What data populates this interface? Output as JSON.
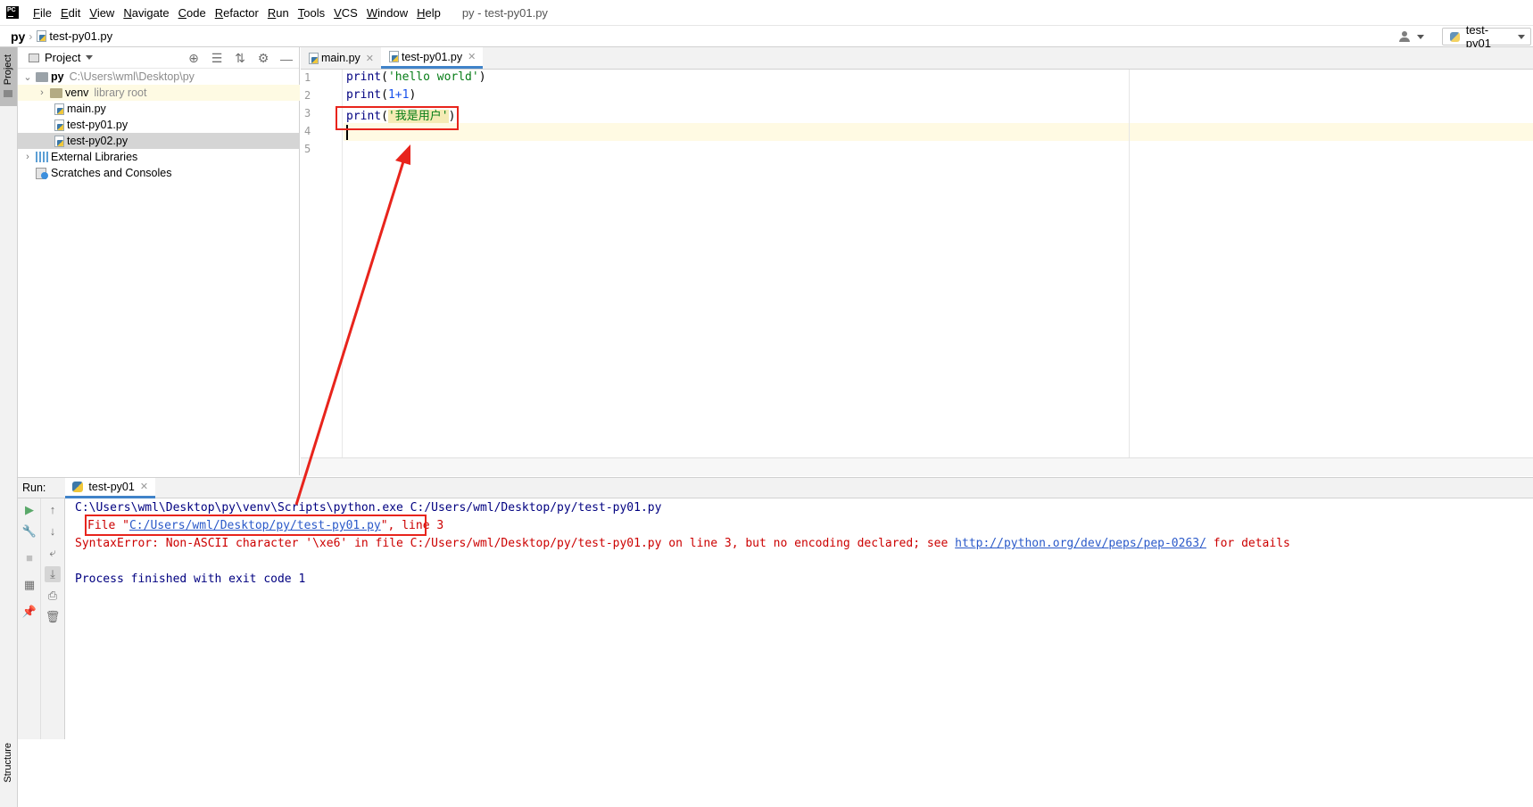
{
  "menubar": {
    "logo_text": "PC",
    "items": [
      "File",
      "Edit",
      "View",
      "Navigate",
      "Code",
      "Refactor",
      "Run",
      "Tools",
      "VCS",
      "Window",
      "Help"
    ],
    "window_title": "py - test-py01.py"
  },
  "navbar": {
    "project": "py",
    "file": "test-py01.py",
    "run_config": "test-py01"
  },
  "stripe": {
    "project_label": "Project",
    "structure_label": "Structure"
  },
  "project_panel": {
    "title": "Project",
    "tree": [
      {
        "label": "py",
        "detail": "C:\\Users\\wml\\Desktop\\py"
      },
      {
        "label": "venv",
        "detail": "library root"
      },
      {
        "label": "main.py"
      },
      {
        "label": "test-py01.py"
      },
      {
        "label": "test-py02.py"
      },
      {
        "label": "External Libraries"
      },
      {
        "label": "Scratches and Consoles"
      }
    ]
  },
  "editor": {
    "tabs": [
      {
        "label": "main.py"
      },
      {
        "label": "test-py01.py"
      }
    ],
    "line_numbers": [
      "1",
      "2",
      "3",
      "4",
      "5"
    ],
    "lines": [
      {
        "fn": "print",
        "open": "(",
        "arg": "'hello world'",
        "close": ")"
      },
      {
        "fn": "print",
        "open": "(",
        "arg": "1+1",
        "close": ")"
      },
      {
        "fn": "print",
        "open": "(",
        "arg": "'我是用户'",
        "close": ")"
      }
    ]
  },
  "run_panel": {
    "label": "Run:",
    "tab": "test-py01",
    "console": {
      "command": "C:\\Users\\wml\\Desktop\\py\\venv\\Scripts\\python.exe C:/Users/wml/Desktop/py/test-py01.py",
      "file_prefix": "File \"",
      "file_link": "C:/Users/wml/Desktop/py/test-py01.py",
      "file_suffix": "\", line 3",
      "error_text": "SyntaxError: Non-ASCII character '\\xe6' in file C:/Users/wml/Desktop/py/test-py01.py on line 3, but no encoding declared; see ",
      "error_link": "http://python.org/dev/peps/pep-0263/",
      "error_tail": " for details",
      "exit_text": "Process finished with exit code 1"
    }
  },
  "colors": {
    "annotation_red": "#e8241c",
    "accent_blue": "#4083c9",
    "error_red": "#cc0000",
    "keyword_navy": "#000080",
    "string_green": "#067d17"
  }
}
